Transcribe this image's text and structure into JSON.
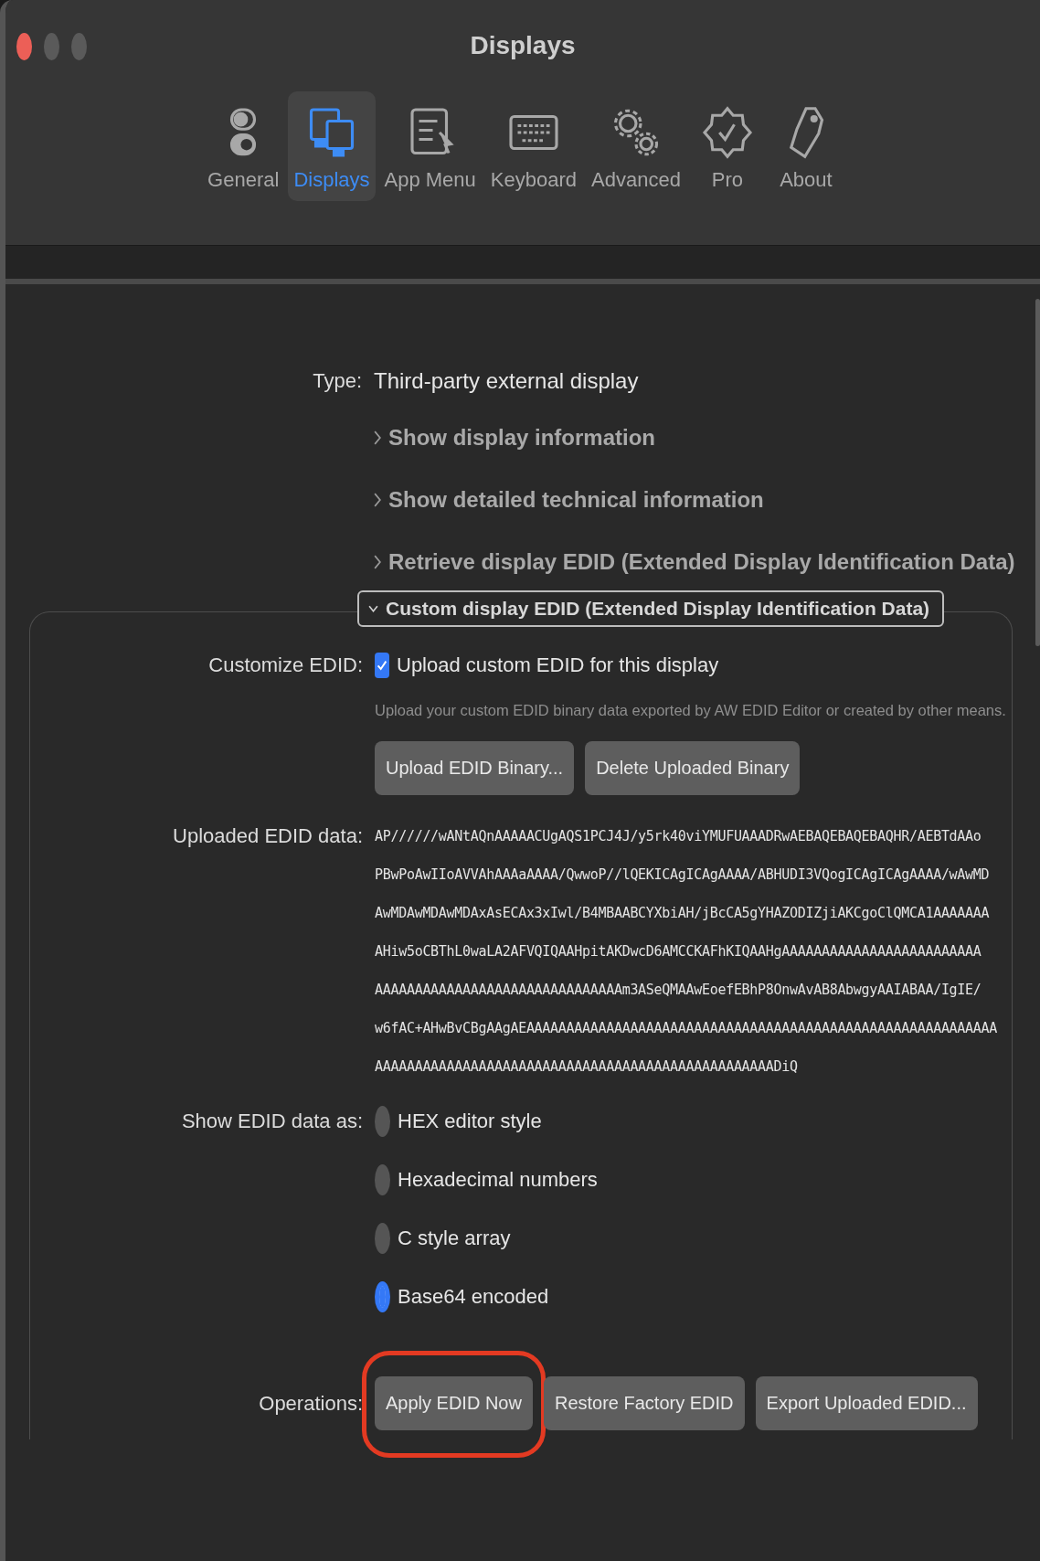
{
  "window": {
    "title": "Displays"
  },
  "toolbar": {
    "tabs": [
      {
        "label": "General",
        "selected": false
      },
      {
        "label": "Displays",
        "selected": true
      },
      {
        "label": "App Menu",
        "selected": false
      },
      {
        "label": "Keyboard",
        "selected": false
      },
      {
        "label": "Advanced",
        "selected": false
      },
      {
        "label": "Pro",
        "selected": false
      },
      {
        "label": "About",
        "selected": false
      }
    ]
  },
  "type": {
    "label": "Type:",
    "value": "Third-party external display"
  },
  "disclosures": [
    {
      "label": "Show display information",
      "expanded": false
    },
    {
      "label": "Show detailed technical information",
      "expanded": false
    },
    {
      "label": "Retrieve display EDID (Extended Display Identification Data)",
      "expanded": false
    },
    {
      "label": "Custom display EDID (Extended Display Identification Data)",
      "expanded": true
    }
  ],
  "customize": {
    "label": "Customize EDID:",
    "checkbox": {
      "label": "Upload custom EDID for this display",
      "checked": true
    },
    "description": "Upload your custom EDID binary data exported by AW EDID Editor or created by other means.",
    "buttons": [
      "Upload EDID Binary...",
      "Delete Uploaded Binary"
    ]
  },
  "uploaded": {
    "label": "Uploaded EDID data:",
    "lines": [
      "AP//////wANtAQnAAAAACUgAQS1PCJ4J/y5rk40viYMUFUAAADRwAEBAQEBAQEBAQHR/AEBTdAAo",
      "PBwPoAwIIoAVVAhAAAaAAAA/QwwoP//lQEKICAgICAgAAAA/ABHUDI3VQogICAgICAgAAAA/wAwMD",
      "AwMDAwMDAwMDAxAsECAx3xIwl/B4MBAABCYXbiAH/jBcCA5gYHAZODIZjiAKCgoClQMCA1AAAAAAA",
      "AHiw5oCBThL0waLA2AFVQIQAAHpitAKDwcD6AMCCKAFhKIQAAHgAAAAAAAAAAAAAAAAAAAAAAAAA",
      "AAAAAAAAAAAAAAAAAAAAAAAAAAAAAAAm3ASeQMAAwEoefEBhP8OnwAvAB8AbwgyAAIABAA/IgIE/",
      "w6fAC+AHwBvCBgAAgAEAAAAAAAAAAAAAAAAAAAAAAAAAAAAAAAAAAAAAAAAAAAAAAAAAAAAAAAAAAA",
      "AAAAAAAAAAAAAAAAAAAAAAAAAAAAAAAAAAAAAAAAAAAAAAAAAADiQ"
    ]
  },
  "show_as": {
    "label": "Show EDID data as:",
    "options": [
      {
        "label": "HEX editor style",
        "selected": false
      },
      {
        "label": "Hexadecimal numbers",
        "selected": false
      },
      {
        "label": "C style array",
        "selected": false
      },
      {
        "label": "Base64 encoded",
        "selected": true
      }
    ]
  },
  "operations": {
    "label": "Operations:",
    "buttons": [
      {
        "label": "Apply EDID Now",
        "highlighted": true
      },
      {
        "label": "Restore Factory EDID",
        "highlighted": false
      },
      {
        "label": "Export Uploaded EDID...",
        "highlighted": false
      }
    ]
  }
}
